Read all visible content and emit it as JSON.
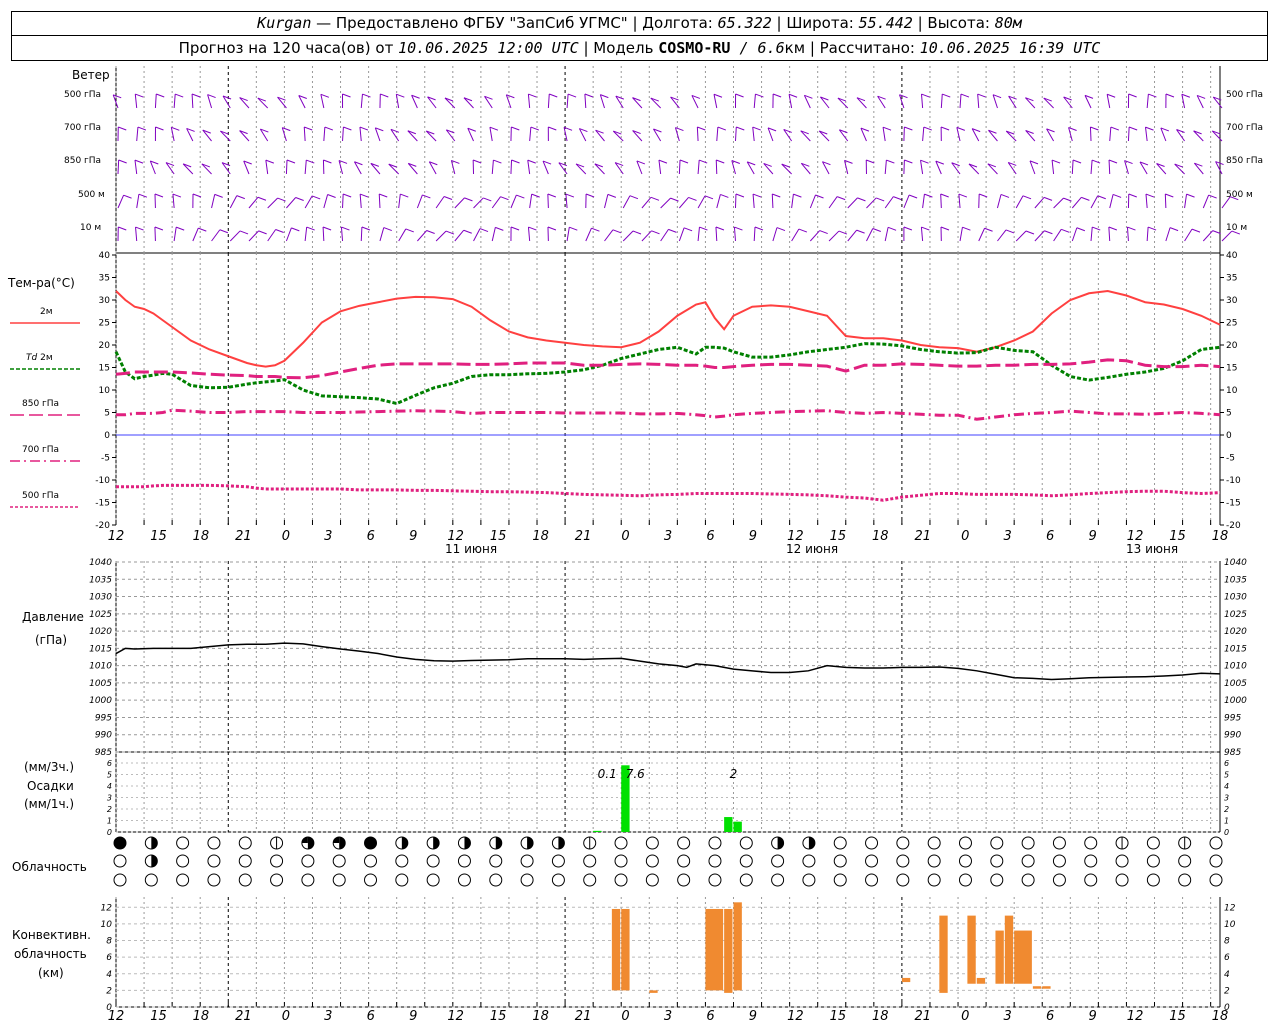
{
  "header": {
    "station": "Kurgan",
    "dash": " — ",
    "provider": "Предоставлено ФГБУ \"ЗапСиб УГМС\"",
    "sep": " | ",
    "lon_label": "Долгота: ",
    "lon_value": "65.322",
    "lat_label": "Широта: ",
    "lat_value": "55.442",
    "alt_label": "Высота: ",
    "alt_value": "80м"
  },
  "subheader": {
    "forecast_label": "Прогноз на 120 часа(ов) от ",
    "forecast_time": "10.06.2025 12:00 UTC",
    "model_label": "  | Модель ",
    "model_name": "COSMO-RU",
    "model_res": " / 6.6",
    "model_unit": "км",
    "calc_label": " | Рассчитано: ",
    "calc_time": "10.06.2025 16:39 UTC"
  },
  "panels": {
    "wind": {
      "title": "Ветер",
      "levels": [
        "500 гПа",
        "700 гПа",
        "850 гПа",
        "500 м",
        "10 м"
      ],
      "barb_color": "#8000c0"
    },
    "temperature": {
      "title": "Тем-ра(°С)",
      "legend": [
        {
          "label": "2м",
          "label_extra": "",
          "color": "#ff4040",
          "dash": ""
        },
        {
          "label": "Td",
          "label_extra": "2м",
          "color": "#008000",
          "dash": "4,2"
        },
        {
          "label": "850 гПа",
          "label_extra": "",
          "color": "#e0207f",
          "dash": "14,5"
        },
        {
          "label": "700 гПа",
          "label_extra": "",
          "color": "#e0207f",
          "dash": "10,4,2,4"
        },
        {
          "label": "500 гПа",
          "label_extra": "",
          "color": "#e0207f",
          "dash": "3,2"
        }
      ]
    },
    "pressure": {
      "title_line1": "Давление",
      "title_line2": "(гПа)"
    },
    "precip": {
      "line1": "(мм/3ч.)",
      "line2": "Осадки",
      "line3": "(мм/1ч.)"
    },
    "cloud": {
      "title": "Облачность"
    },
    "convective": {
      "line1": "Конвективн.",
      "line2": "облачность",
      "line3": "(км)"
    }
  },
  "time_axis": {
    "tick_labels": [
      "12",
      "15",
      "18",
      "21",
      "0",
      "3",
      "6",
      "9",
      "12",
      "15",
      "18",
      "21",
      "0",
      "3",
      "6",
      "9",
      "12",
      "15",
      "18",
      "21",
      "0",
      "3",
      "6",
      "9",
      "12",
      "15",
      "18"
    ],
    "day_labels": [
      "11 июня",
      "12 июня",
      "13 июня"
    ]
  },
  "chart_data": [
    {
      "type": "line",
      "name": "temperature",
      "x_hours": [
        0,
        1,
        2,
        3,
        4,
        5,
        6,
        8,
        10,
        12,
        14,
        15,
        16,
        17,
        18,
        20,
        22,
        24,
        26,
        28,
        30,
        32,
        34,
        36,
        38,
        40,
        42,
        44,
        46,
        48,
        50,
        52,
        54,
        56,
        58,
        60,
        62,
        63,
        64,
        65,
        66,
        68,
        70,
        72,
        74,
        76,
        78,
        80,
        82,
        84,
        86,
        88,
        90,
        92,
        94,
        96,
        98,
        100,
        102,
        104,
        106,
        108,
        110,
        112,
        114,
        116,
        118
      ],
      "ylim": [
        -20,
        40
      ],
      "yticks": [
        -20,
        -15,
        -10,
        -5,
        0,
        5,
        10,
        15,
        20,
        25,
        30,
        35,
        40
      ],
      "series": [
        {
          "name": "2м",
          "values": [
            32,
            30,
            28.5,
            28,
            27,
            25.5,
            24,
            21,
            19,
            17.5,
            16,
            15.5,
            15.2,
            15.5,
            16.5,
            20.5,
            25,
            27.5,
            28.7,
            29.5,
            30.3,
            30.7,
            30.6,
            30.2,
            28.5,
            25.5,
            23,
            21.7,
            21,
            20.5,
            20,
            19.7,
            19.5,
            20.5,
            23,
            26.5,
            29,
            29.5,
            26,
            23.5,
            26.5,
            28.5,
            28.8,
            28.5,
            27.5,
            26.5,
            22,
            21.5,
            21.5,
            21,
            20,
            19.5,
            19.3,
            18.5,
            19.5,
            21,
            23,
            27,
            30,
            31.5,
            32,
            31,
            29.5,
            29,
            28,
            26.5,
            24.5
          ]
        },
        {
          "name": "Td",
          "values": [
            18.5,
            14,
            12.5,
            13,
            13.3,
            13.7,
            13.5,
            11,
            10.5,
            10.6,
            11.3,
            11.6,
            11.8,
            12,
            12.3,
            10,
            8.7,
            8.5,
            8.3,
            8,
            7,
            8.8,
            10.5,
            11.5,
            13,
            13.4,
            13.4,
            13.6,
            13.7,
            14,
            14.5,
            15.5,
            17,
            18,
            19,
            19.5,
            18,
            19.5,
            19.5,
            19.3,
            18.5,
            17.3,
            17.3,
            17.8,
            18.5,
            19,
            19.5,
            20.3,
            20.2,
            19.8,
            19,
            18.5,
            18.2,
            18.3,
            19.5,
            18.8,
            18.5,
            15.5,
            13,
            12.2,
            12.8,
            13.5,
            14,
            14.8,
            16.5,
            19,
            19.5
          ]
        },
        {
          "name": "850 гПа",
          "values": [
            13.5,
            13.7,
            14,
            14,
            14,
            14,
            14,
            13.8,
            13.5,
            13.3,
            13.2,
            13,
            13,
            13,
            12.8,
            12.7,
            13.2,
            14,
            14.8,
            15.5,
            15.8,
            15.8,
            15.8,
            15.8,
            15.7,
            15.7,
            15.8,
            16,
            16,
            16,
            15.5,
            15.5,
            15.7,
            15.8,
            15.7,
            15.5,
            15.5,
            15.3,
            15,
            15,
            15.2,
            15.5,
            15.7,
            15.7,
            15.5,
            15.3,
            14.2,
            15.5,
            15.5,
            15.8,
            15.7,
            15.5,
            15.3,
            15.3,
            15.5,
            15.5,
            15.7,
            15.7,
            15.8,
            16.2,
            16.7,
            16.5,
            15.5,
            15.2,
            15.2,
            15.5,
            15.2
          ]
        },
        {
          "name": "700 гПа",
          "values": [
            4.5,
            4.5,
            4.8,
            4.8,
            4.8,
            5,
            5.5,
            5.3,
            5,
            5,
            5.2,
            5.2,
            5.2,
            5.2,
            5.2,
            5,
            5,
            5,
            5.1,
            5.2,
            5.3,
            5.4,
            5.3,
            5.2,
            4.8,
            5,
            5,
            5,
            5,
            4.9,
            4.9,
            4.9,
            4.9,
            4.7,
            4.7,
            4.8,
            4.5,
            4.3,
            4,
            4.2,
            4.5,
            4.8,
            5,
            5.2,
            5.3,
            5.4,
            5,
            4.8,
            5,
            4.8,
            4.6,
            4.4,
            4.4,
            3.5,
            4,
            4.5,
            4.8,
            5,
            5.3,
            5,
            4.7,
            4.7,
            4.6,
            4.8,
            5,
            4.8,
            4.5
          ]
        },
        {
          "name": "500 гПа",
          "values": [
            -11.5,
            -11.5,
            -11.5,
            -11.5,
            -11.3,
            -11.2,
            -11.2,
            -11.2,
            -11.2,
            -11.3,
            -11.5,
            -11.8,
            -12,
            -12,
            -12,
            -12,
            -12,
            -12,
            -12.2,
            -12.2,
            -12.2,
            -12.3,
            -12.3,
            -12.4,
            -12.5,
            -12.6,
            -12.6,
            -12.7,
            -12.8,
            -13,
            -13.2,
            -13.3,
            -13.4,
            -13.5,
            -13.3,
            -13.2,
            -13,
            -13,
            -13,
            -13,
            -13,
            -13,
            -13.1,
            -13.2,
            -13.3,
            -13.5,
            -13.8,
            -14,
            -14.5,
            -13.8,
            -13.4,
            -13,
            -13,
            -13.2,
            -13.2,
            -13.2,
            -13.3,
            -13.5,
            -13.3,
            -13,
            -12.8,
            -12.6,
            -12.5,
            -12.5,
            -12.8,
            -13,
            -12.8
          ]
        }
      ]
    },
    {
      "type": "line",
      "name": "pressure",
      "x_hours": [
        0,
        1,
        2,
        4,
        6,
        8,
        10,
        12,
        14,
        16,
        18,
        20,
        22,
        24,
        26,
        28,
        30,
        32,
        34,
        36,
        38,
        40,
        42,
        44,
        46,
        48,
        50,
        52,
        54,
        56,
        58,
        60,
        61,
        62,
        64,
        66,
        68,
        70,
        72,
        74,
        76,
        78,
        80,
        82,
        84,
        86,
        88,
        90,
        92,
        94,
        96,
        98,
        100,
        102,
        104,
        106,
        108,
        110,
        112,
        114,
        116,
        118
      ],
      "ylim": [
        985,
        1040
      ],
      "yticks": [
        985,
        990,
        995,
        1000,
        1005,
        1010,
        1015,
        1020,
        1025,
        1030,
        1035,
        1040
      ],
      "series": [
        {
          "name": "Давление",
          "values": [
            1013.5,
            1015,
            1014.8,
            1015,
            1015,
            1015,
            1015.5,
            1016,
            1016.2,
            1016.2,
            1016.5,
            1016.3,
            1015.5,
            1014.8,
            1014.2,
            1013.5,
            1012.5,
            1011.8,
            1011.4,
            1011.3,
            1011.5,
            1011.6,
            1011.7,
            1012,
            1012,
            1012,
            1011.8,
            1012,
            1012.1,
            1011.3,
            1010.5,
            1010,
            1009.5,
            1010.5,
            1010,
            1009,
            1008.5,
            1008,
            1008,
            1008.5,
            1010,
            1009.5,
            1009.3,
            1009.3,
            1009.5,
            1009.5,
            1009.6,
            1009.2,
            1008.5,
            1007.5,
            1006.5,
            1006.3,
            1006,
            1006.2,
            1006.5,
            1006.6,
            1006.7,
            1006.8,
            1007,
            1007.3,
            1007.8,
            1007.6
          ]
        }
      ]
    },
    {
      "type": "bar",
      "name": "precipitation",
      "ylim": [
        0,
        6
      ],
      "yticks": [
        0,
        1,
        2,
        3,
        4,
        5,
        6
      ],
      "bars": [
        {
          "x_hour": 51,
          "value": 0.1
        },
        {
          "x_hour": 54,
          "value": 5.8
        },
        {
          "x_hour": 65,
          "value": 1.3
        },
        {
          "x_hour": 66,
          "value": 0.9
        }
      ],
      "labels": [
        {
          "x_hour": 52.5,
          "text": "0.1"
        },
        {
          "x_hour": 55.5,
          "text": "7.6"
        },
        {
          "x_hour": 66,
          "text": "2"
        }
      ]
    },
    {
      "type": "bar",
      "name": "convective_cloud",
      "ylim": [
        0,
        13
      ],
      "yticks": [
        0,
        2,
        4,
        6,
        8,
        10,
        12
      ],
      "bars": [
        {
          "x_start": 53,
          "x_end": 54,
          "base": 2,
          "top": 11.8
        },
        {
          "x_start": 54,
          "x_end": 55,
          "base": 2,
          "top": 11.8
        },
        {
          "x_start": 57,
          "x_end": 58,
          "base": 1.7,
          "top": 2.0
        },
        {
          "x_start": 63,
          "x_end": 65,
          "base": 2,
          "top": 11.8
        },
        {
          "x_start": 65,
          "x_end": 66,
          "base": 1.7,
          "top": 11.8
        },
        {
          "x_start": 66,
          "x_end": 67,
          "base": 2,
          "top": 12.6
        },
        {
          "x_start": 84,
          "x_end": 85,
          "base": 3.0,
          "top": 3.5
        },
        {
          "x_start": 88,
          "x_end": 89,
          "base": 1.7,
          "top": 11.0
        },
        {
          "x_start": 91,
          "x_end": 92,
          "base": 2.8,
          "top": 11.0
        },
        {
          "x_start": 92,
          "x_end": 93,
          "base": 2.8,
          "top": 3.5
        },
        {
          "x_start": 94,
          "x_end": 95,
          "base": 2.8,
          "top": 9.2
        },
        {
          "x_start": 95,
          "x_end": 96,
          "base": 2.8,
          "top": 11.0
        },
        {
          "x_start": 96,
          "x_end": 98,
          "base": 2.8,
          "top": 9.2
        },
        {
          "x_start": 98,
          "x_end": 99,
          "base": 2.2,
          "top": 2.5
        },
        {
          "x_start": 99,
          "x_end": 100,
          "base": 2.2,
          "top": 2.5
        }
      ]
    },
    {
      "type": "table",
      "name": "cloud_cover",
      "description_rows": [
        "upper",
        "middle",
        "lower"
      ],
      "cols": 36,
      "values": [
        [
          4,
          2,
          0,
          0,
          0,
          1,
          3,
          3,
          4,
          2,
          2,
          2,
          2,
          2,
          2,
          1,
          0,
          0,
          0,
          0,
          0,
          2,
          2,
          0,
          0,
          0,
          0,
          0,
          0,
          0,
          0,
          0,
          1,
          0,
          1,
          0
        ],
        [
          0,
          2,
          0,
          0,
          0,
          0,
          0,
          0,
          0,
          0,
          0,
          0,
          0,
          0,
          0,
          0,
          0,
          0,
          0,
          0,
          0,
          0,
          0,
          0,
          0,
          0,
          0,
          0,
          0,
          0,
          0,
          0,
          0,
          0,
          0,
          0
        ],
        [
          0,
          0,
          0,
          0,
          0,
          0,
          0,
          0,
          0,
          0,
          0,
          0,
          0,
          0,
          0,
          0,
          0,
          0,
          0,
          0,
          0,
          0,
          0,
          0,
          0,
          0,
          0,
          0,
          0,
          0,
          0,
          0,
          0,
          0,
          0,
          0
        ]
      ]
    }
  ]
}
